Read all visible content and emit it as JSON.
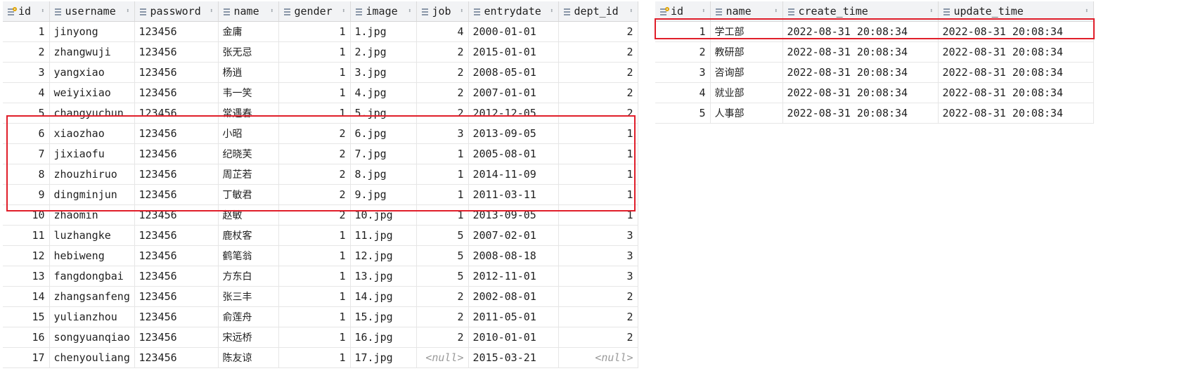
{
  "employee_table": {
    "columns": [
      "id",
      "username",
      "password",
      "name",
      "gender",
      "image",
      "job",
      "entrydate",
      "dept_id"
    ],
    "rows": [
      [
        "1",
        "jinyong",
        "123456",
        "金庸",
        "1",
        "1.jpg",
        "4",
        "2000-01-01",
        "2"
      ],
      [
        "2",
        "zhangwuji",
        "123456",
        "张无忌",
        "1",
        "2.jpg",
        "2",
        "2015-01-01",
        "2"
      ],
      [
        "3",
        "yangxiao",
        "123456",
        "杨逍",
        "1",
        "3.jpg",
        "2",
        "2008-05-01",
        "2"
      ],
      [
        "4",
        "weiyixiao",
        "123456",
        "韦一笑",
        "1",
        "4.jpg",
        "2",
        "2007-01-01",
        "2"
      ],
      [
        "5",
        "changyuchun",
        "123456",
        "常遇春",
        "1",
        "5.jpg",
        "2",
        "2012-12-05",
        "2"
      ],
      [
        "6",
        "xiaozhao",
        "123456",
        "小昭",
        "2",
        "6.jpg",
        "3",
        "2013-09-05",
        "1"
      ],
      [
        "7",
        "jixiaofu",
        "123456",
        "纪晓芙",
        "2",
        "7.jpg",
        "1",
        "2005-08-01",
        "1"
      ],
      [
        "8",
        "zhouzhiruo",
        "123456",
        "周芷若",
        "2",
        "8.jpg",
        "1",
        "2014-11-09",
        "1"
      ],
      [
        "9",
        "dingminjun",
        "123456",
        "丁敏君",
        "2",
        "9.jpg",
        "1",
        "2011-03-11",
        "1"
      ],
      [
        "10",
        "zhaomin",
        "123456",
        "赵敏",
        "2",
        "10.jpg",
        "1",
        "2013-09-05",
        "1"
      ],
      [
        "11",
        "luzhangke",
        "123456",
        "鹿杖客",
        "1",
        "11.jpg",
        "5",
        "2007-02-01",
        "3"
      ],
      [
        "12",
        "hebiweng",
        "123456",
        "鹤笔翁",
        "1",
        "12.jpg",
        "5",
        "2008-08-18",
        "3"
      ],
      [
        "13",
        "fangdongbai",
        "123456",
        "方东白",
        "1",
        "13.jpg",
        "5",
        "2012-11-01",
        "3"
      ],
      [
        "14",
        "zhangsanfeng",
        "123456",
        "张三丰",
        "1",
        "14.jpg",
        "2",
        "2002-08-01",
        "2"
      ],
      [
        "15",
        "yulianzhou",
        "123456",
        "俞莲舟",
        "1",
        "15.jpg",
        "2",
        "2011-05-01",
        "2"
      ],
      [
        "16",
        "songyuanqiao",
        "123456",
        "宋远桥",
        "1",
        "16.jpg",
        "2",
        "2010-01-01",
        "2"
      ],
      [
        "17",
        "chenyouliang",
        "123456",
        "陈友谅",
        "1",
        "17.jpg",
        "<null>",
        "2015-03-21",
        "<null>"
      ]
    ]
  },
  "dept_table": {
    "columns": [
      "id",
      "name",
      "create_time",
      "update_time"
    ],
    "rows": [
      [
        "1",
        "学工部",
        "2022-08-31 20:08:34",
        "2022-08-31 20:08:34"
      ],
      [
        "2",
        "教研部",
        "2022-08-31 20:08:34",
        "2022-08-31 20:08:34"
      ],
      [
        "3",
        "咨询部",
        "2022-08-31 20:08:34",
        "2022-08-31 20:08:34"
      ],
      [
        "4",
        "就业部",
        "2022-08-31 20:08:34",
        "2022-08-31 20:08:34"
      ],
      [
        "5",
        "人事部",
        "2022-08-31 20:08:34",
        "2022-08-31 20:08:34"
      ]
    ]
  },
  "null_text": "<null>",
  "highlight_color": "#e01e2a",
  "icons": {
    "column": "column-icon",
    "primary_key": "key-icon",
    "sort": "sort-arrows-icon"
  }
}
